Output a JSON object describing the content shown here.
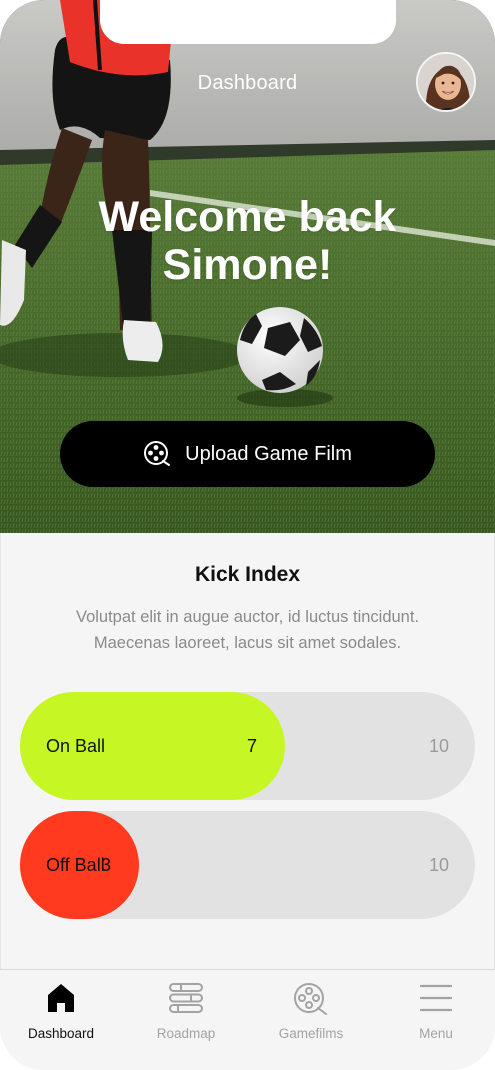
{
  "header": {
    "title": "Dashboard",
    "avatar_icon": "user-avatar"
  },
  "hero": {
    "greeting_line1": "Welcome back",
    "greeting_line2": "Simone!",
    "upload_button_label": "Upload Game Film",
    "upload_icon": "film-reel-icon"
  },
  "kick_index": {
    "title": "Kick Index",
    "description_line1": "Volutpat elit in augue auctor, id luctus tincidunt.",
    "description_line2": "Maecenas laoreet, lacus sit amet sodales.",
    "bars": [
      {
        "label": "On Ball",
        "value": "7",
        "max": "10",
        "fraction": 0.7,
        "color": "#c6f725"
      },
      {
        "label": "Off Ball",
        "value": "3",
        "max": "10",
        "fraction": 0.3,
        "color": "#ff3a1f"
      }
    ]
  },
  "nav": {
    "items": [
      {
        "label": "Dashboard",
        "icon": "home-icon",
        "active": true
      },
      {
        "label": "Roadmap",
        "icon": "roadmap-icon",
        "active": false
      },
      {
        "label": "Gamefilms",
        "icon": "film-reel-icon",
        "active": false
      },
      {
        "label": "Menu",
        "icon": "hamburger-menu-icon",
        "active": false
      }
    ]
  }
}
